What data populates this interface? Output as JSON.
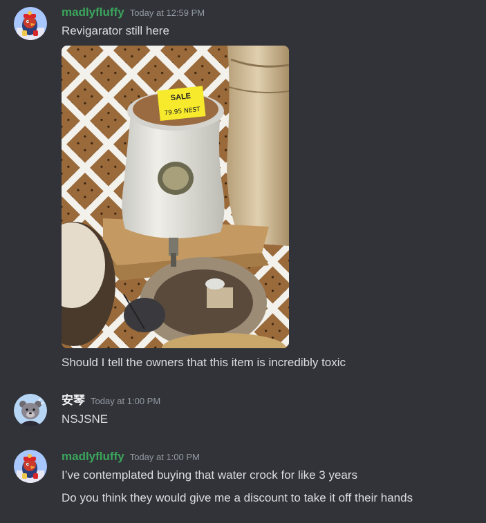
{
  "colors": {
    "background": "#313338",
    "username_primary": "#23a559",
    "username_secondary": "#f2f3f5",
    "timestamp": "#949ba4",
    "text": "#dbdee1"
  },
  "messages": [
    {
      "author": "madlyfluffy",
      "author_color": "#3ba55c",
      "timestamp": "Today at 12:59 PM",
      "avatar_icon": "parrot-avatar-icon",
      "lines": [
        "Revigarator still here"
      ],
      "attachment": {
        "type": "photo",
        "sign_text": "SALE",
        "price_text": "79.95 NEST"
      },
      "after_lines": [
        "Should I tell the owners that this item is incredibly toxic"
      ]
    },
    {
      "author": "安琴",
      "author_color": "#f2f3f5",
      "timestamp": "Today at 1:00 PM",
      "avatar_icon": "bear-avatar-icon",
      "lines": [
        "NSJSNE"
      ]
    },
    {
      "author": "madlyfluffy",
      "author_color": "#3ba55c",
      "timestamp": "Today at 1:00 PM",
      "avatar_icon": "parrot-avatar-icon",
      "lines": [
        "I’ve contemplated buying that water crock for like 3 years",
        "Do you think they would give me a discount to take it off their hands"
      ]
    }
  ]
}
